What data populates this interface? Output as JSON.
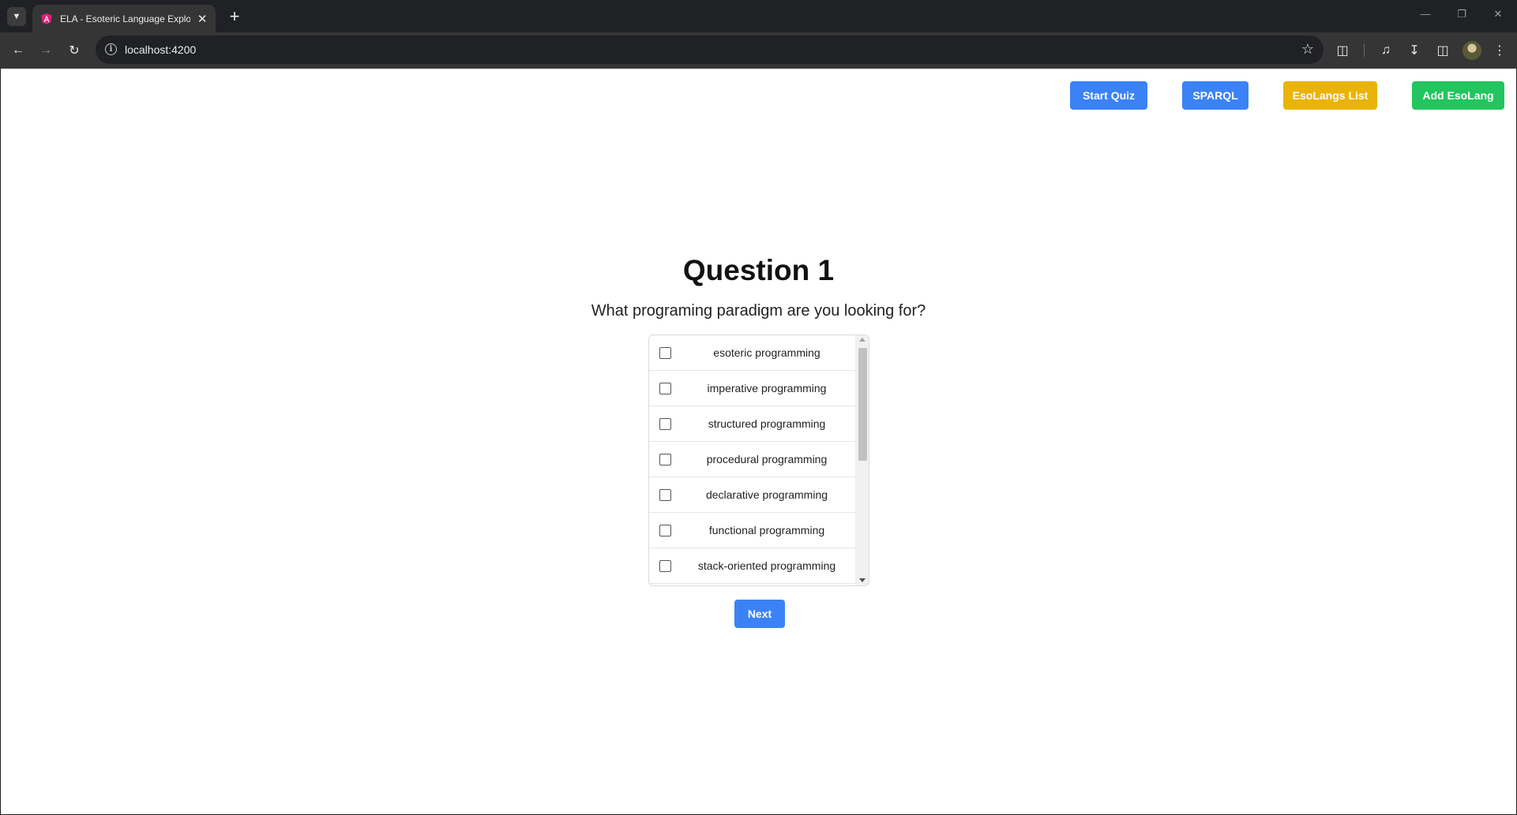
{
  "browser": {
    "tab_title": "ELA - Esoteric Language Explorer",
    "new_tab_icon": "+",
    "url": "localhost:4200"
  },
  "nav": {
    "start_quiz": "Start Quiz",
    "sparql": "SPARQL",
    "esolangs_list": "EsoLangs List",
    "add_esolang": "Add EsoLang"
  },
  "quiz": {
    "title": "Question 1",
    "question": "What programing paradigm are you looking for?",
    "options": [
      {
        "label": "esoteric programming",
        "checked": false
      },
      {
        "label": "imperative programming",
        "checked": false
      },
      {
        "label": "structured programming",
        "checked": false
      },
      {
        "label": "procedural programming",
        "checked": false
      },
      {
        "label": "declarative programming",
        "checked": false
      },
      {
        "label": "functional programming",
        "checked": false
      },
      {
        "label": "stack-oriented programming",
        "checked": false
      }
    ],
    "next_label": "Next"
  },
  "colors": {
    "primary": "#3b82f6",
    "warning": "#eab308",
    "success": "#22c55e"
  }
}
